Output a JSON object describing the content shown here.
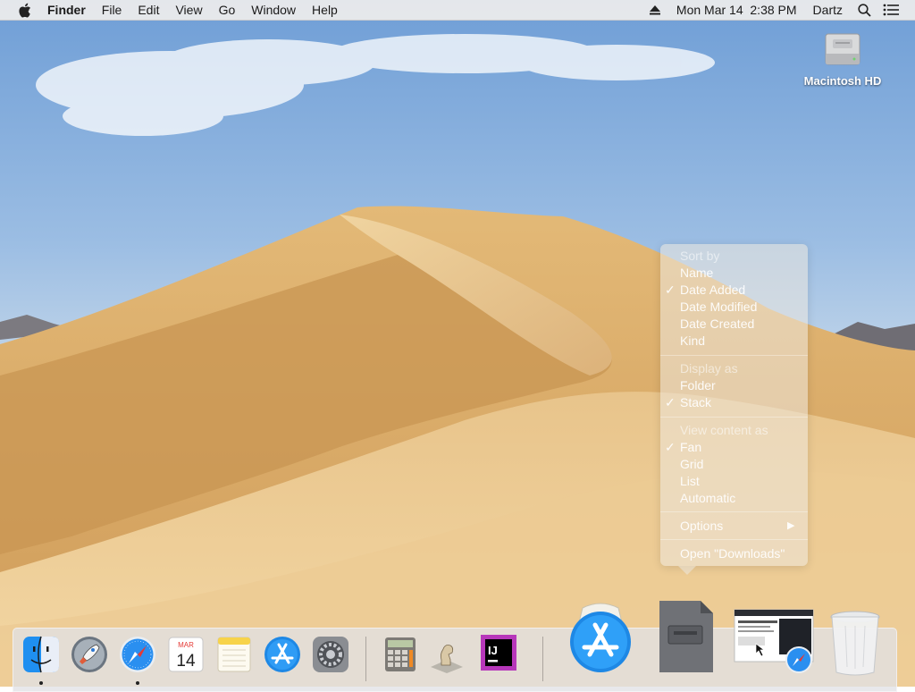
{
  "menubar": {
    "app_name": "Finder",
    "menus": [
      "File",
      "Edit",
      "View",
      "Go",
      "Window",
      "Help"
    ],
    "clock": "Mon Mar 14  2:38 PM",
    "user": "Dartz",
    "icons": [
      "apple-logo",
      "eject-icon",
      "spotlight-search-icon",
      "notification-center-icon"
    ]
  },
  "desktop": {
    "drive_label": "Macintosh HD"
  },
  "stack_menu": {
    "sort_header": "Sort by",
    "sort_items": [
      "Name",
      "Date Added",
      "Date Modified",
      "Date Created",
      "Kind"
    ],
    "sort_checked": "Date Added",
    "display_header": "Display as",
    "display_items": [
      "Folder",
      "Stack"
    ],
    "display_checked": "Stack",
    "view_header": "View content as",
    "view_items": [
      "Fan",
      "Grid",
      "List",
      "Automatic"
    ],
    "view_checked": "Fan",
    "options_label": "Options",
    "open_label": "Open \"Downloads\"",
    "check_glyph": "✓",
    "submenu_glyph": "▶"
  },
  "dock": {
    "apps": [
      "Finder",
      "Launchpad",
      "Safari",
      "Calendar",
      "Notes",
      "App Store",
      "System Preferences",
      "Calculator",
      "Chess",
      "IntelliJ IDEA"
    ],
    "calendar_month": "MAR",
    "calendar_day": "14",
    "intellij_label": "IJ",
    "stacks": [
      "App Store download",
      "Downloads",
      "Screenshot"
    ],
    "trash": "Trash"
  }
}
